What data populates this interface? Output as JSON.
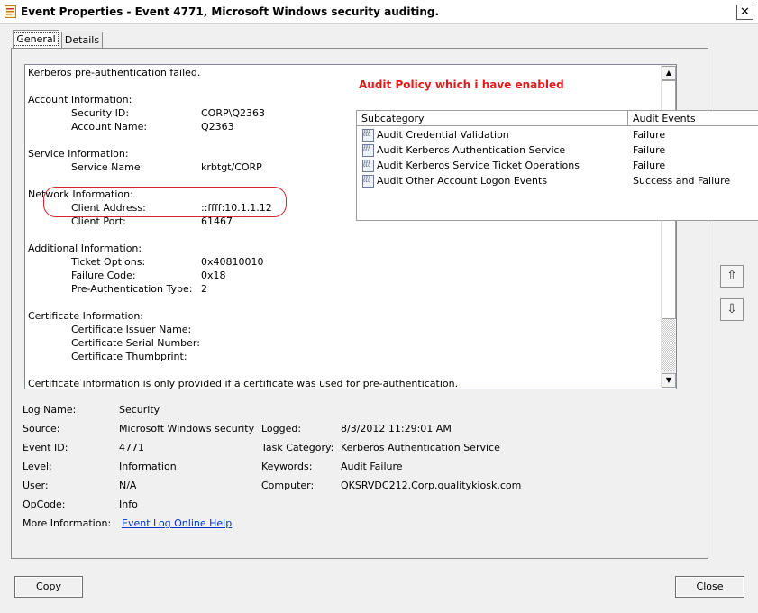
{
  "window": {
    "title": "Event Properties - Event 4771, Microsoft Windows security auditing.",
    "close_glyph": "✕"
  },
  "tabs": [
    {
      "label": "General",
      "active": true
    },
    {
      "label": "Details",
      "active": false
    }
  ],
  "description": {
    "header": "Kerberos pre-authentication failed.",
    "account_information": "Account Information:",
    "security_id_label": "Security ID:",
    "security_id_value": "CORP\\Q2363",
    "account_name_label": "Account Name:",
    "account_name_value": "Q2363",
    "service_information": "Service Information:",
    "service_name_label": "Service Name:",
    "service_name_value": "krbtgt/CORP",
    "network_information": "Network Information:",
    "client_address_label": "Client Address:",
    "client_address_value": "::ffff:10.1.1.12",
    "client_port_label": "Client Port:",
    "client_port_value": "61467",
    "additional_information": "Additional Information:",
    "ticket_options_label": "Ticket Options:",
    "ticket_options_value": "0x40810010",
    "failure_code_label": "Failure Code:",
    "failure_code_value": "0x18",
    "preauth_type_label": "Pre-Authentication Type:",
    "preauth_type_value": "2",
    "certificate_information": "Certificate Information:",
    "cert_issuer_label": "Certificate Issuer Name:",
    "cert_serial_label": "Certificate Serial Number:",
    "cert_thumbprint_label": "Certificate Thumbprint:",
    "footer": "Certificate information is only provided if a certificate was used for pre-authentication."
  },
  "annotation": "Audit Policy which i have enabled",
  "audit_policy": {
    "columns": [
      "Subcategory",
      "Audit Events"
    ],
    "icon": "policy-icon",
    "rows": [
      {
        "subcategory": "Audit Credential Validation",
        "events": "Failure"
      },
      {
        "subcategory": "Audit Kerberos Authentication Service",
        "events": "Failure"
      },
      {
        "subcategory": "Audit Kerberos Service Ticket Operations",
        "events": "Failure"
      },
      {
        "subcategory": "Audit Other Account Logon Events",
        "events": "Success and Failure"
      }
    ]
  },
  "properties": {
    "log_name_label": "Log Name:",
    "log_name_value": "Security",
    "source_label": "Source:",
    "source_value": "Microsoft Windows security",
    "logged_label": "Logged:",
    "logged_value": "8/3/2012 11:29:01 AM",
    "event_id_label": "Event ID:",
    "event_id_value": "4771",
    "task_category_label": "Task Category:",
    "task_category_value": "Kerberos Authentication Service",
    "level_label": "Level:",
    "level_value": "Information",
    "keywords_label": "Keywords:",
    "keywords_value": "Audit Failure",
    "user_label": "User:",
    "user_value": "N/A",
    "computer_label": "Computer:",
    "computer_value": "QKSRVDC212.Corp.qualitykiosk.com",
    "opcode_label": "OpCode:",
    "opcode_value": "Info",
    "more_info_label": "More Information:",
    "more_info_link": "Event Log Online Help"
  },
  "buttons": {
    "copy": "Copy",
    "close": "Close"
  },
  "colors": {
    "annotation": "#e01b1b",
    "highlight": "#d9232a",
    "link": "#0033cc"
  }
}
